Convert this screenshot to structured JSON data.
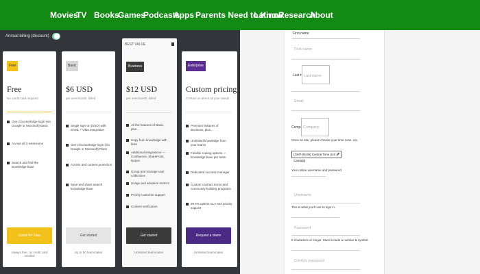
{
  "nav": [
    "Movies",
    "TV",
    "Books",
    "Games",
    "Podcasts",
    "Apps",
    "Parents Need to Know",
    "Latino",
    "Research",
    "About"
  ],
  "billing_toggle": {
    "label": "Annual billing (discount)",
    "on": true
  },
  "plans": [
    {
      "badge": "Free",
      "badge_color": "#f2c21b",
      "price": "Free",
      "sub": "No credit card required",
      "features": [
        "One Chrome/Edge login (via Google or Microsoft) Basic",
        "Accept all 3 extensions",
        "Search and find the knowledge base"
      ],
      "cta": "Install for Free",
      "cta_color": "#f2c21b",
      "foot": "Always free, no credit card needed"
    },
    {
      "badge": "Basic",
      "badge_color": "#d7d7d7",
      "price": "$6 USD",
      "sub": "per user/month, billed",
      "features": [
        "Single sign-on (SSO) with SAML + Okta integration",
        "One Chrome/Edge login (via Google or Microsoft) Plans",
        "Access and content protection",
        "Save and share search knowledge base"
      ],
      "cta": "Get started",
      "cta_color": "#e5e5e5",
      "foot": "Up to 50 teammates"
    },
    {
      "topbar": "BEST VALUE",
      "badge": "Business",
      "badge_color": "#3a3a3a",
      "price": "$12 USD",
      "sub": "per user/month, billed",
      "features": [
        "All the features of Basic, plus...",
        "Copy from knowledge with links",
        "Additional integrations — Confluence, SharePoint, Notion",
        "Group and manage user collections",
        "Usage and adoption metrics",
        "Priority customer support",
        "Content verification"
      ],
      "cta": "Get started",
      "cta_color": "#3a3a3a",
      "foot": "Unlimited teammates"
    },
    {
      "badge": "Enterprise",
      "badge_color": "#5b2d90",
      "price": "Custom pricing",
      "sub": "Contact us about all your needs",
      "features": [
        "Premium features of Business, plus...",
        "Unlimited knowledge from your teams",
        "Flexible routing options — knowledge base per team",
        "Dedicated success manager",
        "Custom contract terms and community building programs",
        "99.9% uptime SLA and priority support"
      ],
      "cta": "Request a demo",
      "cta_color": "#4b2a85",
      "foot": "Unlimited teammates"
    }
  ],
  "form": {
    "first_name_label": "First name",
    "first_name_placeholder": "First name",
    "last_name_label": "Last name",
    "last_name_placeholder": "Last name",
    "email_placeholder": "Email",
    "company_label": "Company",
    "company_placeholder": "Company",
    "timezone_label": "Once on site, please choose your time zone, etc.",
    "timezone_value": "(GMT-05:00) Central Time (US & Canada)",
    "account_label": "Your online username and password",
    "username_placeholder": "Username",
    "username_help": "This is what you'll use to sign in.",
    "password_placeholder": "Password",
    "password_help": "8 characters or longer. Must include a number & symbol.",
    "confirm_placeholder": "Confirm password"
  }
}
